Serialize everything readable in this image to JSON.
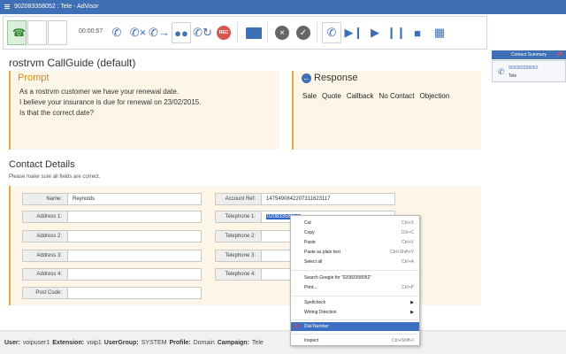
{
  "titlebar": {
    "title": "902083358052 : Tele - AdVisor"
  },
  "toolbar": {
    "timer": "00:00:57",
    "icons": [
      "dial-icon",
      "hangup-icon",
      "transfer-icon",
      "conference-icon",
      "callback-icon",
      "record-icon",
      "email-icon",
      "cancel-icon",
      "check-icon",
      "schedule-icon",
      "next-icon",
      "play-icon",
      "pause-icon",
      "stop-icon",
      "calendar-icon"
    ]
  },
  "callguide": {
    "title": "rostrvm CallGuide (default)"
  },
  "prompt": {
    "heading": "Prompt",
    "lines": [
      "As a rostrvm customer we have your renewal date.",
      "I believe your insurance is due for renewal on 23/02/2015.",
      "Is that the correct date?"
    ]
  },
  "response": {
    "heading": "Response",
    "options": [
      "Sale",
      "Quote",
      "Callback",
      "No Contact",
      "Objection"
    ]
  },
  "contact": {
    "title": "Contact Details",
    "subtitle": "Please make sure all fields are correct.",
    "left_fields": [
      {
        "label": "Name:",
        "value": "Reynolds"
      },
      {
        "label": "Address 1:",
        "value": ""
      },
      {
        "label": "Address 2:",
        "value": ""
      },
      {
        "label": "Address 3:",
        "value": ""
      },
      {
        "label": "Address 4:",
        "value": ""
      },
      {
        "label": "Post Code:",
        "value": ""
      }
    ],
    "right_fields": [
      {
        "label": "Account Ref:",
        "value": "14754908422073116231​17"
      },
      {
        "label": "Telephone 1:",
        "value": "02083358052"
      },
      {
        "label": "Telephone 2:",
        "value": ""
      },
      {
        "label": "Telephone 3:",
        "value": ""
      },
      {
        "label": "Telephone 4:",
        "value": ""
      }
    ]
  },
  "context_menu": {
    "items": [
      {
        "label": "Cut",
        "shortcut": "Ctrl+X"
      },
      {
        "label": "Copy",
        "shortcut": "Ctrl+C"
      },
      {
        "label": "Paste",
        "shortcut": "Ctrl+V"
      },
      {
        "label": "Paste as plain text",
        "shortcut": "Ctrl+Shift+V"
      },
      {
        "label": "Select all",
        "shortcut": "Ctrl+A"
      },
      {
        "label": "Search Google for “02083358052”",
        "shortcut": ""
      },
      {
        "label": "Print...",
        "shortcut": "Ctrl+P"
      },
      {
        "label": "Spellcheck",
        "shortcut": ""
      },
      {
        "label": "Writing Direction",
        "shortcut": ""
      },
      {
        "label": "Dial Number",
        "shortcut": ""
      },
      {
        "label": "Inspect",
        "shortcut": "Ctrl+Shift+I"
      }
    ]
  },
  "summary": {
    "heading": "Contact Summary",
    "number": "902083358052",
    "name": "Tele"
  },
  "status": {
    "user_label": "User:",
    "user": "voipuser1",
    "ext_label": "Extension:",
    "ext": "voip1",
    "group_label": "UserGroup:",
    "group": "SYSTEM",
    "profile_label": "Profile:",
    "profile": "Domain",
    "campaign_label": "Campaign:",
    "campaign": "Tele"
  }
}
